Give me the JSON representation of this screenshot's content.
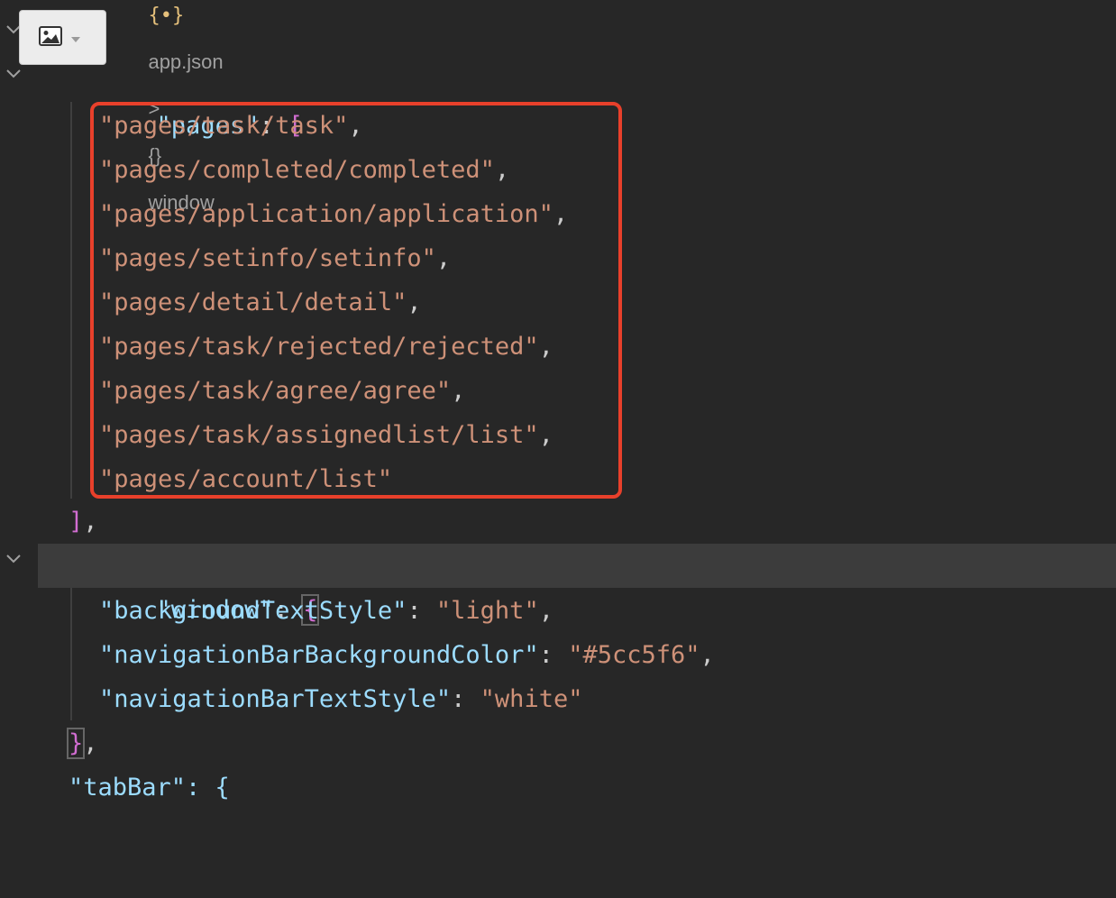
{
  "breadcrumb": {
    "file_icon": "{•}",
    "file": "app.json",
    "separator": ">",
    "node_icon": "{}",
    "node": "window"
  },
  "toolbar_button": {
    "icon": "image-icon",
    "dropdown_icon": "caret-down-icon"
  },
  "colors": {
    "background": "#272727",
    "key": "#9cdcfe",
    "string": "#ce9178",
    "bracket": "#d16dd1",
    "highlight_box": "#e8402b",
    "active_line": "#3c3c3c"
  },
  "code": {
    "pages_key": "\"pages\"",
    "colon": ":",
    "open_bracket": "[",
    "pages": [
      {
        "value": "\"pages/task/task\"",
        "comma": ","
      },
      {
        "value": "\"pages/completed/completed\"",
        "comma": ","
      },
      {
        "value": "\"pages/application/application\"",
        "comma": ","
      },
      {
        "value": "\"pages/setinfo/setinfo\"",
        "comma": ","
      },
      {
        "value": "\"pages/detail/detail\"",
        "comma": ","
      },
      {
        "value": "\"pages/task/rejected/rejected\"",
        "comma": ","
      },
      {
        "value": "\"pages/task/agree/agree\"",
        "comma": ","
      },
      {
        "value": "\"pages/task/assignedlist/list\"",
        "comma": ","
      },
      {
        "value": "\"pages/account/list\"",
        "comma": ""
      }
    ],
    "close_bracket": "]",
    "close_comma": ",",
    "window_key": "\"window\"",
    "open_brace": "{",
    "window_entries": [
      {
        "key": "\"backgroundTextStyle\"",
        "value": "\"light\"",
        "comma": ","
      },
      {
        "key": "\"navigationBarBackgroundColor\"",
        "value": "\"#5cc5f6\"",
        "comma": ","
      },
      {
        "key": "\"navigationBarTextStyle\"",
        "value": "\"white\"",
        "comma": ""
      }
    ],
    "close_brace": "}",
    "partial_next_key": "\"tabBar\": {"
  }
}
